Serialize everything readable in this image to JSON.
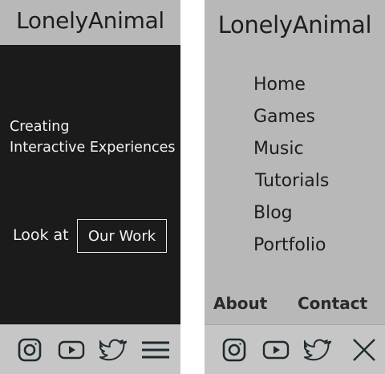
{
  "home_screen": {
    "logo": "LonelyAnimal",
    "tagline_line1": "Creating",
    "tagline_line2": "Interactive Experiences",
    "cta_prefix": "Look at",
    "cta_button": "Our Work"
  },
  "menu_screen": {
    "logo": "LonelyAnimal",
    "nav_items": [
      {
        "label": "Home"
      },
      {
        "label": "Games"
      },
      {
        "label": "Music"
      },
      {
        "label": "Tutorials"
      },
      {
        "label": "Blog"
      },
      {
        "label": "Portfolio"
      }
    ],
    "about": "About",
    "contact": "Contact"
  },
  "footer_icons": [
    "instagram-icon",
    "youtube-icon",
    "twitter-icon"
  ],
  "colors": {
    "header_bg": "#b8b8b8",
    "hero_bg": "#1b1b1b",
    "footer_bg": "#c6c6c6",
    "text_dark": "#1d1d1d",
    "text_light": "#f1f1f1"
  }
}
